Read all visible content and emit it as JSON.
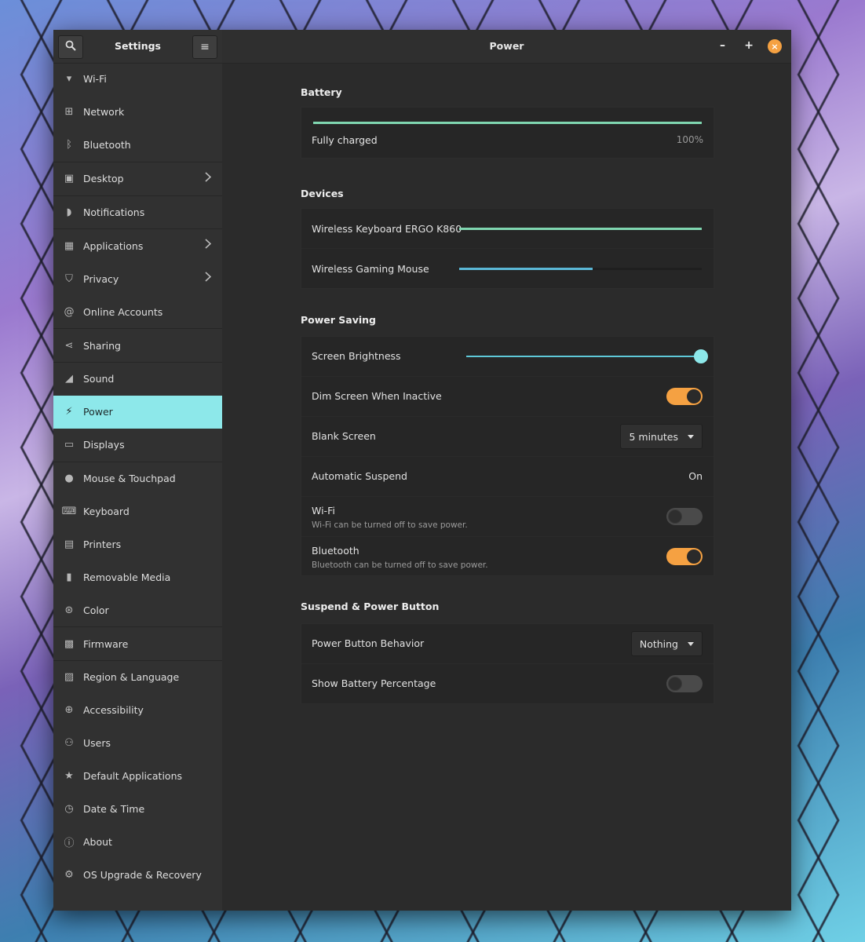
{
  "sidebar": {
    "title": "Settings",
    "search_icon": "search-icon",
    "menu_icon": "hamburger-menu-icon",
    "items": [
      {
        "label": "Wi-Fi",
        "icon": "wifi-icon",
        "glyph": "▾"
      },
      {
        "label": "Network",
        "icon": "network-icon",
        "glyph": "⊞"
      },
      {
        "label": "Bluetooth",
        "icon": "bluetooth-icon",
        "glyph": "ᛒ"
      },
      {
        "label": "Desktop",
        "icon": "desktop-icon",
        "glyph": "▣",
        "chevron": true
      },
      {
        "label": "Notifications",
        "icon": "notifications-icon",
        "glyph": "◗"
      },
      {
        "label": "Applications",
        "icon": "applications-icon",
        "glyph": "▦",
        "chevron": true
      },
      {
        "label": "Privacy",
        "icon": "privacy-icon",
        "glyph": "⛉",
        "chevron": true
      },
      {
        "label": "Online Accounts",
        "icon": "online-accounts-icon",
        "glyph": "@"
      },
      {
        "label": "Sharing",
        "icon": "sharing-icon",
        "glyph": "⋖"
      },
      {
        "label": "Sound",
        "icon": "sound-icon",
        "glyph": "◢"
      },
      {
        "label": "Power",
        "icon": "power-icon",
        "glyph": "⚡"
      },
      {
        "label": "Displays",
        "icon": "displays-icon",
        "glyph": "▭"
      },
      {
        "label": "Mouse & Touchpad",
        "icon": "mouse-icon",
        "glyph": "●"
      },
      {
        "label": "Keyboard",
        "icon": "keyboard-icon",
        "glyph": "⌨"
      },
      {
        "label": "Printers",
        "icon": "printer-icon",
        "glyph": "▤"
      },
      {
        "label": "Removable Media",
        "icon": "removable-media-icon",
        "glyph": "▮"
      },
      {
        "label": "Color",
        "icon": "color-icon",
        "glyph": "⊛"
      },
      {
        "label": "Firmware",
        "icon": "firmware-icon",
        "glyph": "▩"
      },
      {
        "label": "Region & Language",
        "icon": "region-language-icon",
        "glyph": "▨"
      },
      {
        "label": "Accessibility",
        "icon": "accessibility-icon",
        "glyph": "⊕"
      },
      {
        "label": "Users",
        "icon": "users-icon",
        "glyph": "⚇"
      },
      {
        "label": "Default Applications",
        "icon": "default-applications-icon",
        "glyph": "★"
      },
      {
        "label": "Date & Time",
        "icon": "date-time-icon",
        "glyph": "◷"
      },
      {
        "label": "About",
        "icon": "about-icon",
        "glyph": "ⓘ"
      },
      {
        "label": "OS Upgrade & Recovery",
        "icon": "os-upgrade-icon",
        "glyph": "⚙"
      }
    ],
    "active_index": 10
  },
  "header": {
    "title": "Power",
    "minimize": "–",
    "maximize": "+",
    "close": "×"
  },
  "battery": {
    "section": "Battery",
    "status": "Fully charged",
    "percent": "100%",
    "level": 1.0,
    "color": "#7fd6b0"
  },
  "devices": {
    "section": "Devices",
    "items": [
      {
        "label": "Wireless Keyboard ERGO K860",
        "level": 1.0,
        "color": "#7fd6b0"
      },
      {
        "label": "Wireless Gaming Mouse",
        "level": 0.55,
        "color": "#5bb8d6"
      }
    ]
  },
  "power_saving": {
    "section": "Power Saving",
    "screen_brightness": {
      "label": "Screen Brightness",
      "level": 1.0,
      "color": "#5ec8d8"
    },
    "dim_screen": {
      "label": "Dim Screen When Inactive",
      "on": true
    },
    "blank_screen": {
      "label": "Blank Screen",
      "value": "5 minutes"
    },
    "automatic_suspend": {
      "label": "Automatic Suspend",
      "value": "On"
    },
    "wifi": {
      "label": "Wi-Fi",
      "sub": "Wi-Fi can be turned off to save power.",
      "on": false
    },
    "bluetooth": {
      "label": "Bluetooth",
      "sub": "Bluetooth can be turned off to save power.",
      "on": true
    }
  },
  "suspend": {
    "section": "Suspend & Power Button",
    "power_button": {
      "label": "Power Button Behavior",
      "value": "Nothing"
    },
    "battery_percentage": {
      "label": "Show Battery Percentage",
      "on": false
    }
  },
  "colors": {
    "accent": "#8de8ea",
    "toggle_on": "#f5a142",
    "close": "#f5a142"
  }
}
